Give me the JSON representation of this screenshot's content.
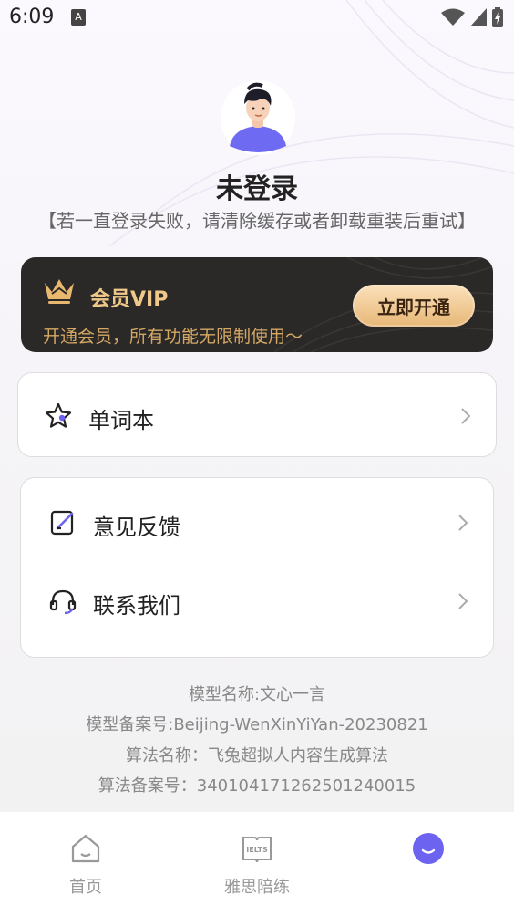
{
  "status_bar": {
    "time": "6:09",
    "notif_letter": "A"
  },
  "profile": {
    "name": "未登录",
    "hint": "【若一直登录失败，请清除缓存或者卸载重装后重试】"
  },
  "vip": {
    "title": "会员VIP",
    "description": "开通会员，所有功能无限制使用～",
    "button_label": "立即开通"
  },
  "menu": {
    "vocab_label": "单词本",
    "feedback_label": "意见反馈",
    "contact_label": "联系我们"
  },
  "info": {
    "model_name": "模型名称:文心一言",
    "model_record": "模型备案号:Beijing-WenXinYiYan-20230821",
    "algo_name": "算法名称：飞兔超拟人内容生成算法",
    "algo_record": "算法备案号：340104171262501240015"
  },
  "nav": {
    "home_label": "首页",
    "ielts_label": "雅思陪练",
    "ielts_icon_text": "IELTS"
  },
  "colors": {
    "accent": "#6c63f0",
    "vip_gold": "#f0c98a",
    "vip_bg": "#2b2928"
  }
}
